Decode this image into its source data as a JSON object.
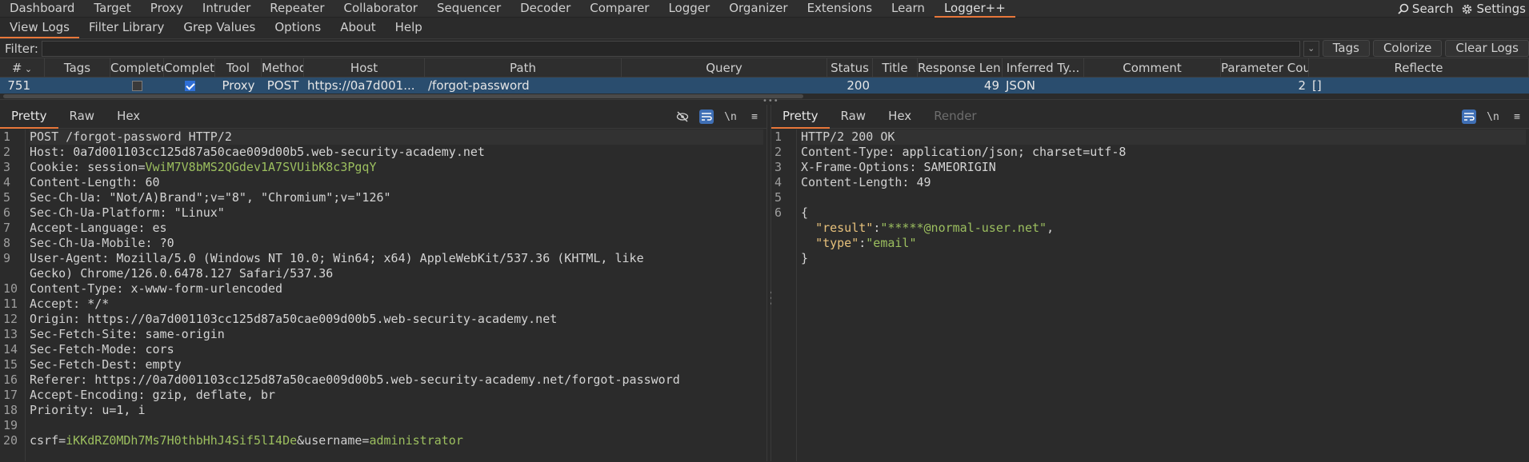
{
  "top_tabs": [
    "Dashboard",
    "Target",
    "Proxy",
    "Intruder",
    "Repeater",
    "Collaborator",
    "Sequencer",
    "Decoder",
    "Comparer",
    "Logger",
    "Organizer",
    "Extensions",
    "Learn",
    "Logger++"
  ],
  "top_right": {
    "search": "Search",
    "settings": "Settings"
  },
  "sub_tabs": [
    "View Logs",
    "Filter Library",
    "Grep Values",
    "Options",
    "About",
    "Help"
  ],
  "filter": {
    "label": "Filter:",
    "value": "",
    "buttons": [
      "Tags",
      "Colorize",
      "Clear Logs"
    ]
  },
  "columns": [
    "#",
    "Tags",
    "Complete",
    "Complete",
    "Tool",
    "Method",
    "Host",
    "Path",
    "Query",
    "Status",
    "Title",
    "Response Len...",
    "Inferred Ty...",
    "Comment",
    "Parameter Count",
    "Reflecte"
  ],
  "row": {
    "num": "751",
    "tags": "",
    "complete1": false,
    "complete2": true,
    "tool": "Proxy",
    "method": "POST",
    "host": "https://0a7d001...",
    "path": "/forgot-password",
    "query": "",
    "status": "200",
    "title": "",
    "resp_len": "49",
    "inferred": "JSON",
    "comment": "",
    "param_count": "2",
    "reflected": "[]"
  },
  "request_pane": {
    "tabs": [
      "Pretty",
      "Raw",
      "Hex"
    ],
    "tools": [
      "eye-off-icon",
      "wrap-icon",
      "\\n",
      "menu-icon"
    ],
    "gutter": [
      "1",
      "2",
      "3",
      "4",
      "5",
      "6",
      "7",
      "8",
      "9",
      "",
      "10",
      "11",
      "12",
      "13",
      "14",
      "15",
      "16",
      "17",
      "18",
      "19",
      "20"
    ],
    "lines": [
      {
        "k": "POST /forgot-password HTTP/2",
        "v": ""
      },
      {
        "k": "Host: ",
        "v": "0a7d001103cc125d87a50cae009d00b5.web-security-academy.net"
      },
      {
        "k": "Cookie: session=",
        "v": "VwiM7V8bMS2QGdev1A7SVUibK8c3PgqY",
        "green": true
      },
      {
        "k": "Content-Length: ",
        "v": "60"
      },
      {
        "k": "Sec-Ch-Ua: ",
        "v": "\"Not/A)Brand\";v=\"8\", \"Chromium\";v=\"126\""
      },
      {
        "k": "Sec-Ch-Ua-Platform: ",
        "v": "\"Linux\""
      },
      {
        "k": "Accept-Language: ",
        "v": "es"
      },
      {
        "k": "Sec-Ch-Ua-Mobile: ",
        "v": "?0"
      },
      {
        "k": "User-Agent: ",
        "v": "Mozilla/5.0 (Windows NT 10.0; Win64; x64) AppleWebKit/537.36 (KHTML, like"
      },
      {
        "k": "",
        "v": "Gecko) Chrome/126.0.6478.127 Safari/537.36"
      },
      {
        "k": "Content-Type: ",
        "v": "x-www-form-urlencoded"
      },
      {
        "k": "Accept: ",
        "v": "*/*"
      },
      {
        "k": "Origin: ",
        "v": "https://0a7d001103cc125d87a50cae009d00b5.web-security-academy.net"
      },
      {
        "k": "Sec-Fetch-Site: ",
        "v": "same-origin"
      },
      {
        "k": "Sec-Fetch-Mode: ",
        "v": "cors"
      },
      {
        "k": "Sec-Fetch-Dest: ",
        "v": "empty"
      },
      {
        "k": "Referer: ",
        "v": "https://0a7d001103cc125d87a50cae009d00b5.web-security-academy.net/forgot-password"
      },
      {
        "k": "Accept-Encoding: ",
        "v": "gzip, deflate, br"
      },
      {
        "k": "Priority: ",
        "v": "u=1, i"
      },
      {
        "k": "",
        "v": ""
      },
      {
        "k": "",
        "v": ""
      }
    ],
    "body": {
      "k1": "csrf=",
      "v1": "iKKdRZ0MDh7Ms7H0thbHhJ4Sif5lI4De",
      "sep": "&",
      "k2": "username=",
      "v2": "administrator"
    }
  },
  "response_pane": {
    "tabs": [
      "Pretty",
      "Raw",
      "Hex",
      "Render"
    ],
    "tools": [
      "wrap-icon",
      "\\n",
      "menu-icon"
    ],
    "gutter": [
      "1",
      "2",
      "3",
      "4",
      "5",
      "6",
      "",
      "",
      ""
    ],
    "lines": [
      {
        "k": "HTTP/2 200 OK",
        "v": ""
      },
      {
        "k": "Content-Type: ",
        "v": "application/json; charset=utf-8"
      },
      {
        "k": "X-Frame-Options: ",
        "v": "SAMEORIGIN"
      },
      {
        "k": "Content-Length: ",
        "v": "49"
      },
      {
        "k": "",
        "v": ""
      }
    ],
    "json": {
      "open": "{",
      "result_key": "\"result\"",
      "result_val": "\"*****@normal-user.net\"",
      "type_key": "\"type\"",
      "type_val": "\"email\"",
      "close": "}"
    }
  },
  "colors": {
    "accent": "#e8773a",
    "selected_row": "#2a4d6e",
    "string_green": "#9cbf5f"
  }
}
